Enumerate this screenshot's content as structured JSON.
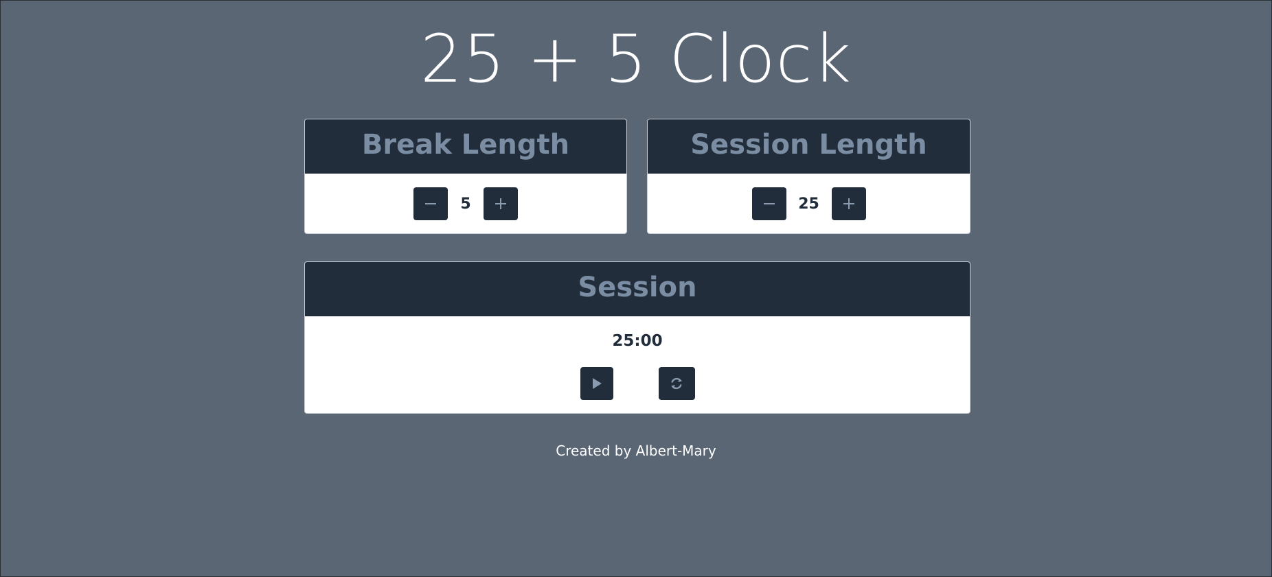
{
  "title": "25 + 5 Clock",
  "break": {
    "label": "Break Length",
    "value": "5",
    "decrement_icon": "minus-icon",
    "increment_icon": "plus-icon"
  },
  "session": {
    "label": "Session Length",
    "value": "25",
    "decrement_icon": "minus-icon",
    "increment_icon": "plus-icon"
  },
  "timer": {
    "label": "Session",
    "time_left": "25:00",
    "start_icon": "play-icon",
    "reset_icon": "refresh-icon"
  },
  "footer": {
    "text": "Created by Albert-Mary"
  },
  "colors": {
    "background": "#5b6675",
    "card_header": "#222d3b",
    "header_text": "#7b8da3",
    "card_body": "#ffffff"
  }
}
